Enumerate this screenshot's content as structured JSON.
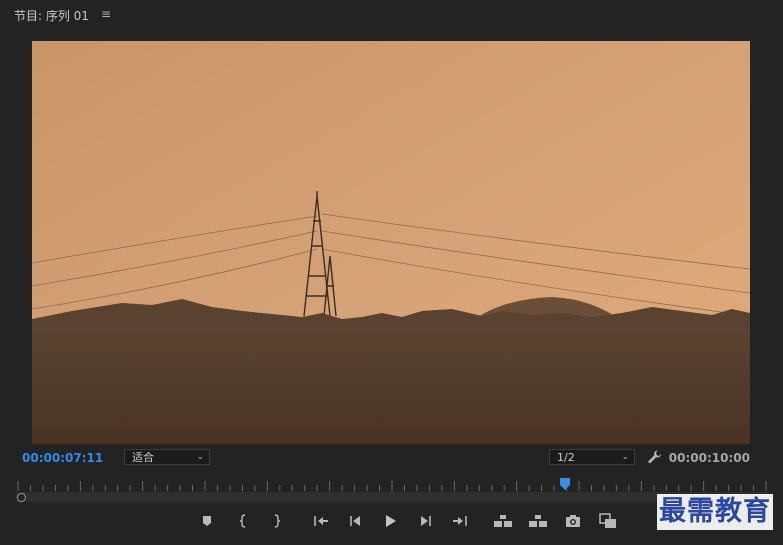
{
  "header": {
    "title": "节目: 序列 01",
    "menu_icon": "hamburger-menu-icon"
  },
  "controls": {
    "current_timecode": "00:00:07:11",
    "zoom_select": {
      "value": "适合"
    },
    "resolution_select": {
      "value": "1/2"
    },
    "duration_timecode": "00:00:10:00",
    "settings_icon": "wrench-icon"
  },
  "timeline": {
    "playhead_fraction": 0.73
  },
  "transport_icons": [
    "add-marker-icon",
    "mark-in-icon",
    "mark-out-icon",
    "go-to-in-icon",
    "step-back-icon",
    "play-icon",
    "step-forward-icon",
    "go-to-out-icon",
    "lift-icon",
    "extract-icon",
    "export-frame-icon",
    "compare-view-icon"
  ],
  "watermark": {
    "text": "最需教育"
  }
}
